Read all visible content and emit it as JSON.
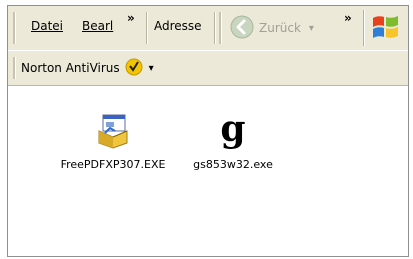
{
  "menubar": {
    "items": [
      "Datei",
      "Bearl"
    ],
    "overflow_glyph": "»"
  },
  "address": {
    "label": "Adresse"
  },
  "nav": {
    "back_label": "Zurück",
    "dropdown_glyph": "▾",
    "overflow_glyph": "»"
  },
  "norton": {
    "label": "Norton AntiVirus",
    "dropdown_glyph": "▾"
  },
  "files": [
    {
      "name": "FreePDFXP307.EXE",
      "icon": "installer-icon"
    },
    {
      "name": "gs853w32.exe",
      "icon": "ghostscript-icon"
    }
  ],
  "colors": {
    "toolbar_bg": "#ece9d8",
    "norton_yellow": "#f5c400",
    "back_green": "#c8d6c0"
  }
}
